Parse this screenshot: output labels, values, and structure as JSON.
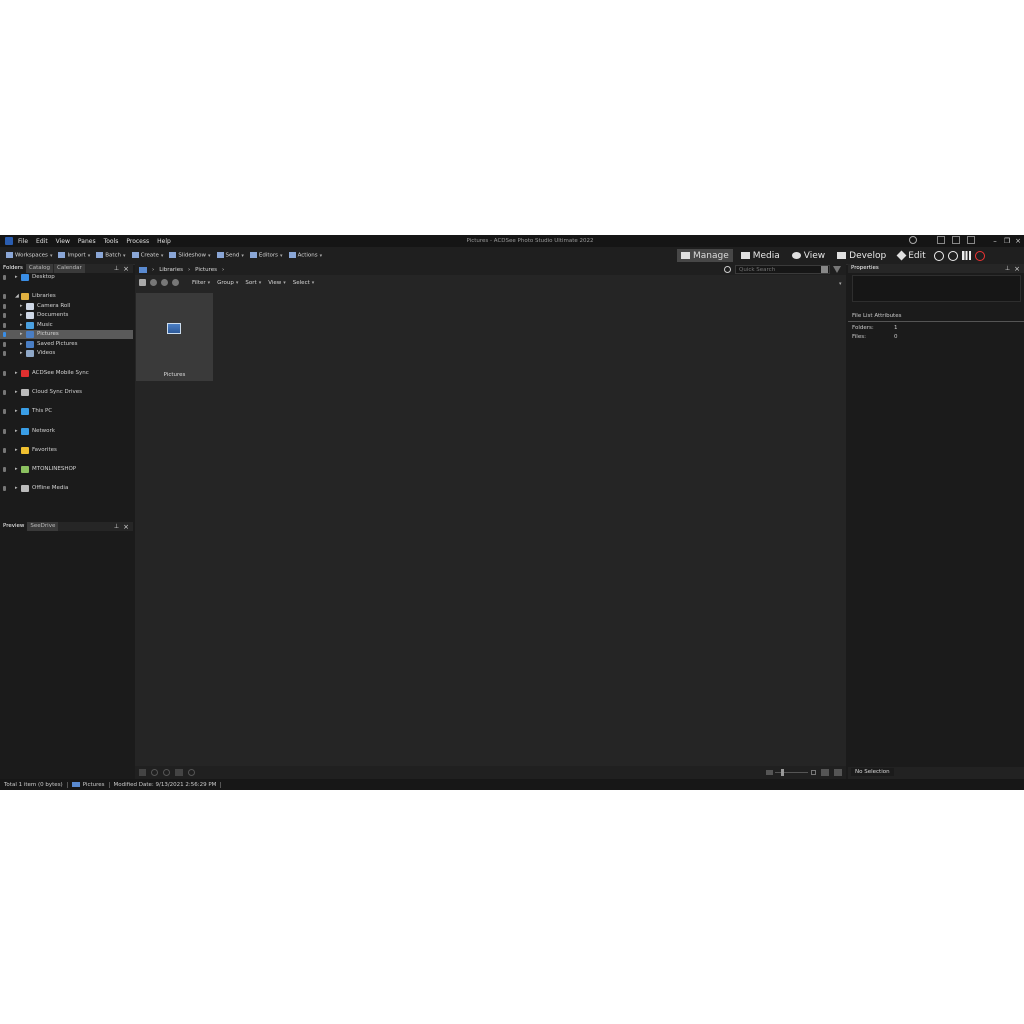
{
  "window": {
    "title": "Pictures - ACDSee Photo Studio Ultimate 2022",
    "menu": [
      "File",
      "Edit",
      "View",
      "Panes",
      "Tools",
      "Process",
      "Help"
    ]
  },
  "toolbar": {
    "items": [
      "Workspaces",
      "Import",
      "Batch",
      "Create",
      "Slideshow",
      "Send",
      "Editors",
      "Actions"
    ],
    "modes": [
      "Manage",
      "Media",
      "View",
      "Develop",
      "Edit"
    ],
    "active_mode": "Manage"
  },
  "left_pane": {
    "tabs": [
      "Folders",
      "Catalog",
      "Calendar"
    ],
    "tree": [
      {
        "label": "Desktop",
        "level": 1,
        "icon": "desktop-icon",
        "color": "#3a8ee6"
      },
      {
        "label": "Libraries",
        "level": 1,
        "icon": "libraries-icon",
        "color": "#e0b040"
      },
      {
        "label": "Camera Roll",
        "level": 2,
        "icon": "camera-roll-icon",
        "color": "#cfd8e6"
      },
      {
        "label": "Documents",
        "level": 2,
        "icon": "documents-icon",
        "color": "#cfd8e6"
      },
      {
        "label": "Music",
        "level": 2,
        "icon": "music-icon",
        "color": "#4aa0e0"
      },
      {
        "label": "Pictures",
        "level": 2,
        "icon": "pictures-icon",
        "color": "#4a7ec4",
        "selected": true
      },
      {
        "label": "Saved Pictures",
        "level": 2,
        "icon": "saved-pictures-icon",
        "color": "#4a7ec4"
      },
      {
        "label": "Videos",
        "level": 2,
        "icon": "videos-icon",
        "color": "#8fa8c8"
      },
      {
        "label": "ACDSee Mobile Sync",
        "level": 1,
        "icon": "mobile-sync-icon",
        "color": "#e03030"
      },
      {
        "label": "Cloud Sync Drives",
        "level": 1,
        "icon": "cloud-icon",
        "color": "#bbbbbb"
      },
      {
        "label": "This PC",
        "level": 1,
        "icon": "pc-icon",
        "color": "#3a9ee6"
      },
      {
        "label": "Network",
        "level": 1,
        "icon": "network-icon",
        "color": "#3a9ee6"
      },
      {
        "label": "Favorites",
        "level": 1,
        "icon": "star-icon",
        "color": "#f0c030"
      },
      {
        "label": "MTONLINESHOP",
        "level": 1,
        "icon": "user-folder-icon",
        "color": "#8bc060"
      },
      {
        "label": "Offline Media",
        "level": 1,
        "icon": "offline-media-icon",
        "color": "#bbbbbb"
      }
    ]
  },
  "preview_pane": {
    "tabs": [
      "Preview",
      "SeeDrive"
    ]
  },
  "center": {
    "breadcrumb": [
      "Libraries",
      "Pictures"
    ],
    "quick_search_placeholder": "Quick Search",
    "filter_menus": [
      "Filter",
      "Group",
      "Sort",
      "View",
      "Select"
    ],
    "thumbnail_label": "Pictures"
  },
  "right_pane": {
    "title": "Properties",
    "section_title": "File List Attributes",
    "rows": [
      {
        "label": "Folders:",
        "value": "1"
      },
      {
        "label": "Files:",
        "value": "0"
      }
    ],
    "footer": "No Selection"
  },
  "status": {
    "total": "Total 1 item  (0 bytes)",
    "folder": "Pictures",
    "modified": "Modified Date: 9/13/2021 2:56:29 PM"
  }
}
